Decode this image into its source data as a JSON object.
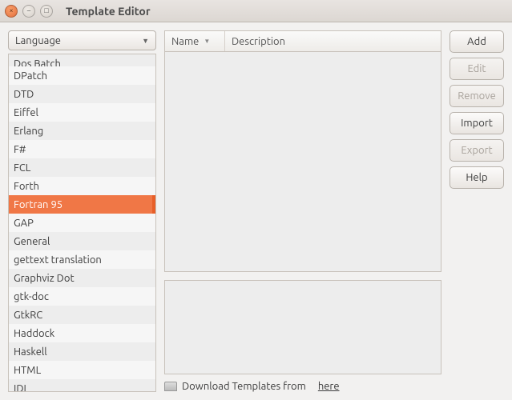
{
  "window": {
    "title": "Template Editor"
  },
  "dropdown": {
    "label": "Language"
  },
  "languages": [
    "Dos Batch",
    "DPatch",
    "DTD",
    "Eiffel",
    "Erlang",
    "F#",
    "FCL",
    "Forth",
    "Fortran 95",
    "GAP",
    "General",
    "gettext translation",
    "Graphviz Dot",
    "gtk-doc",
    "GtkRC",
    "Haddock",
    "Haskell",
    "HTML",
    "IDL"
  ],
  "selected_language": "Fortran 95",
  "table": {
    "name_header": "Name",
    "desc_header": "Description"
  },
  "buttons": {
    "add": "Add",
    "edit": "Edit",
    "remove": "Remove",
    "import": "Import",
    "export": "Export",
    "help": "Help"
  },
  "download": {
    "text": "Download Templates from",
    "link": "here"
  }
}
